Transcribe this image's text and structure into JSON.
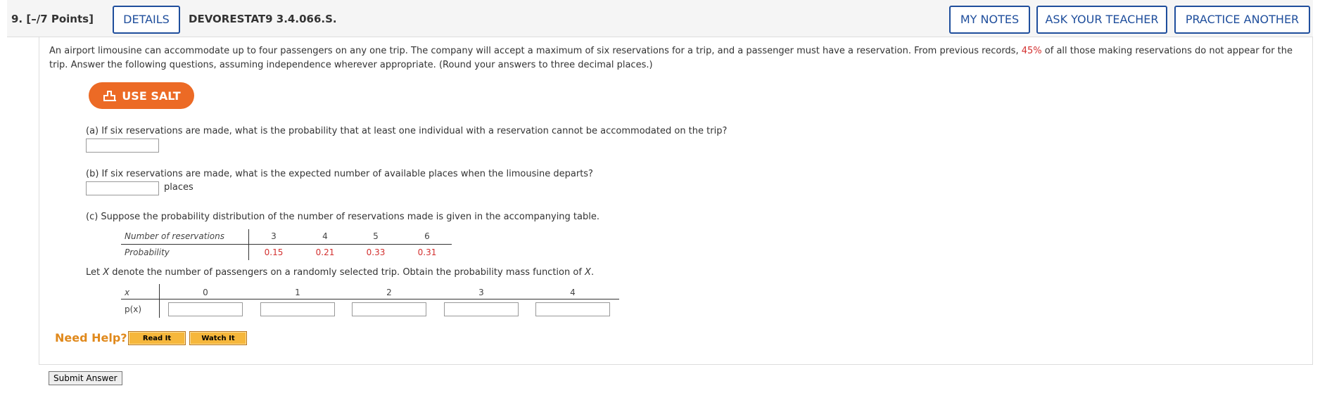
{
  "header": {
    "question_number": "9.",
    "points": "[–/7 Points]",
    "details_label": "DETAILS",
    "problem_code": "DEVORESTAT9 3.4.066.S.",
    "my_notes_label": "MY NOTES",
    "ask_teacher_label": "ASK YOUR TEACHER",
    "practice_another_label": "PRACTICE ANOTHER"
  },
  "prompt": {
    "text_before": "An airport limousine can accommodate up to four passengers on any one trip. The company will accept a maximum of six reservations for a trip, and a passenger must have a reservation. From previous records,",
    "highlight": "45%",
    "text_after": "of all those making reservations do not appear for the trip. Answer the following questions, assuming independence wherever appropriate. (Round your answers to three decimal places.)"
  },
  "salt": {
    "label": "USE SALT",
    "icon": "salt-icon"
  },
  "part_a": {
    "text": "(a) If six reservations are made, what is the probability that at least one individual with a reservation cannot be accommodated on the trip?",
    "value": ""
  },
  "part_b": {
    "text": "(b) If six reservations are made, what is the expected number of available places when the limousine departs?",
    "value": "",
    "unit": "places"
  },
  "part_c": {
    "text": "(c) Suppose the probability distribution of the number of reservations made is given in the accompanying table.",
    "table": {
      "row1_label": "Number of reservations",
      "row2_label": "Probability",
      "reservations": [
        "3",
        "4",
        "5",
        "6"
      ],
      "probabilities": [
        "0.15",
        "0.21",
        "0.33",
        "0.31"
      ]
    },
    "pmf_prompt_prefix": "Let",
    "pmf_prompt_var": "X",
    "pmf_prompt_mid": "denote the number of passengers on a randomly selected trip. Obtain the probability mass function of",
    "pmf_prompt_var2": "X",
    "pmf_prompt_end": ".",
    "pmf_table": {
      "x_label": "x",
      "px_label": "p(x)",
      "x_values": [
        "0",
        "1",
        "2",
        "3",
        "4"
      ],
      "px_inputs": [
        "",
        "",
        "",
        "",
        ""
      ]
    }
  },
  "help": {
    "label": "Need Help?",
    "read_it": "Read It",
    "watch_it": "Watch It"
  },
  "submit_label": "Submit Answer",
  "colors": {
    "accent_blue": "#1f4e9c",
    "salt_orange": "#ec6a25",
    "highlight_red": "#d3302f",
    "help_orange": "#e0891c"
  }
}
